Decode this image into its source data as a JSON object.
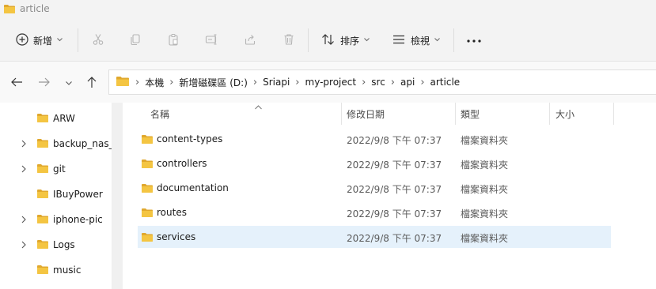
{
  "window": {
    "title": "article"
  },
  "toolbar": {
    "new_label": "新增",
    "sort_label": "排序",
    "view_label": "檢視",
    "more_label": "···"
  },
  "breadcrumb": [
    "本機",
    "新增磁碟區 (D:)",
    "Sriapi",
    "my-project",
    "src",
    "api",
    "article"
  ],
  "sidebar": {
    "items": [
      {
        "label": "ARW",
        "expandable": false
      },
      {
        "label": "backup_nas_",
        "expandable": true
      },
      {
        "label": "git",
        "expandable": true
      },
      {
        "label": "IBuyPower",
        "expandable": false
      },
      {
        "label": "iphone-pic",
        "expandable": true
      },
      {
        "label": "Logs",
        "expandable": true
      },
      {
        "label": "music",
        "expandable": false
      }
    ]
  },
  "list": {
    "columns": {
      "name": "名稱",
      "date": "修改日期",
      "type": "類型",
      "size": "大小"
    },
    "rows": [
      {
        "name": "content-types",
        "date": "2022/9/8 下午 07:37",
        "type": "檔案資料夾"
      },
      {
        "name": "controllers",
        "date": "2022/9/8 下午 07:37",
        "type": "檔案資料夾"
      },
      {
        "name": "documentation",
        "date": "2022/9/8 下午 07:37",
        "type": "檔案資料夾"
      },
      {
        "name": "routes",
        "date": "2022/9/8 下午 07:37",
        "type": "檔案資料夾"
      },
      {
        "name": "services",
        "date": "2022/9/8 下午 07:37",
        "type": "檔案資料夾",
        "selected": true
      }
    ]
  },
  "colors": {
    "folder": "#f4c542",
    "folder_dark": "#e0a82e",
    "selection": "#e5f1fb",
    "accent": "#0067c0"
  }
}
